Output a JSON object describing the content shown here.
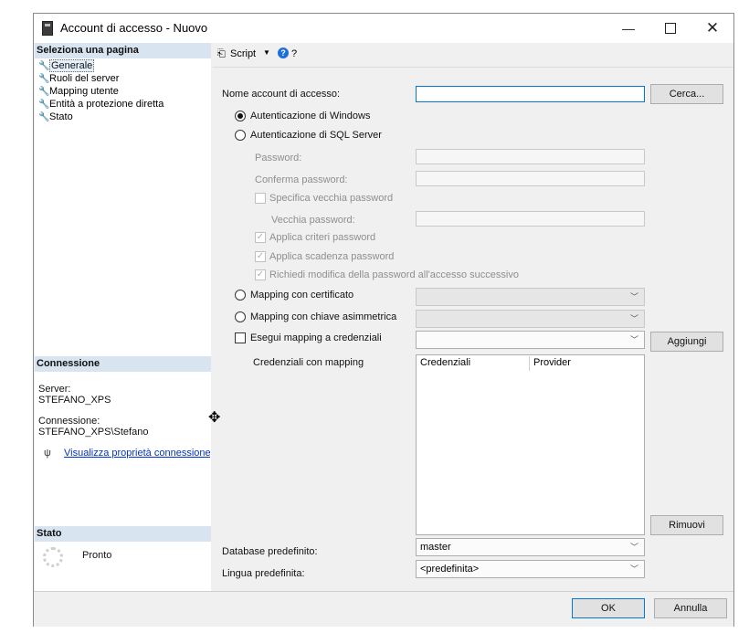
{
  "window": {
    "title": "Account di accesso - Nuovo",
    "minimize_glyph": "—",
    "close_glyph": "✕"
  },
  "left_panel": {
    "select_page_header": "Seleziona una pagina",
    "pages": [
      {
        "label": "Generale",
        "selected": true,
        "icon": "wrench-icon"
      },
      {
        "label": "Ruoli del server",
        "icon": "wrench-icon"
      },
      {
        "label": "Mapping utente",
        "icon": "wrench-icon"
      },
      {
        "label": "Entità a protezione diretta",
        "icon": "wrench-icon"
      },
      {
        "label": "Stato",
        "icon": "wrench-icon"
      }
    ],
    "connection_header": "Connessione",
    "server_label": "Server:",
    "server_value": "STEFANO_XPS",
    "connection_label": "Connessione:",
    "connection_value": "STEFANO_XPS\\Stefano",
    "view_properties_link": "Visualizza proprietà connessione",
    "status_header": "Stato",
    "status_value": "Pronto"
  },
  "toolbar": {
    "script_label": "Script",
    "help_label": "?"
  },
  "form": {
    "login_name_label": "Nome account di accesso:",
    "login_name_value": "",
    "search_button": "Cerca...",
    "windows_auth_label": "Autenticazione di Windows",
    "sql_auth_label": "Autenticazione di SQL Server",
    "password_label": "Password:",
    "confirm_password_label": "Conferma password:",
    "specify_old_password_label": "Specifica vecchia password",
    "old_password_label": "Vecchia password:",
    "enforce_policy_label": "Applica criteri password",
    "enforce_expiration_label": "Applica scadenza password",
    "must_change_label": "Richiedi modifica della password all'accesso successivo",
    "cert_mapping_label": "Mapping con certificato",
    "asym_key_mapping_label": "Mapping con chiave asimmetrica",
    "credential_mapping_label": "Esegui mapping a credenziali",
    "add_button": "Aggiungi",
    "mapped_credentials_label": "Credenziali con mapping",
    "grid_columns": [
      "Credenziali",
      "Provider"
    ],
    "remove_button": "Rimuovi",
    "default_db_label": "Database predefinito:",
    "default_db_value": "master",
    "default_lang_label": "Lingua predefinita:",
    "default_lang_value": "<predefinita>",
    "windows_auth_selected": true
  },
  "footer": {
    "ok_button": "OK",
    "cancel_button": "Annulla"
  },
  "colors": {
    "section_header_bg": "#d9e4f1",
    "focus_border": "#0078d7",
    "link": "#0033cc"
  }
}
